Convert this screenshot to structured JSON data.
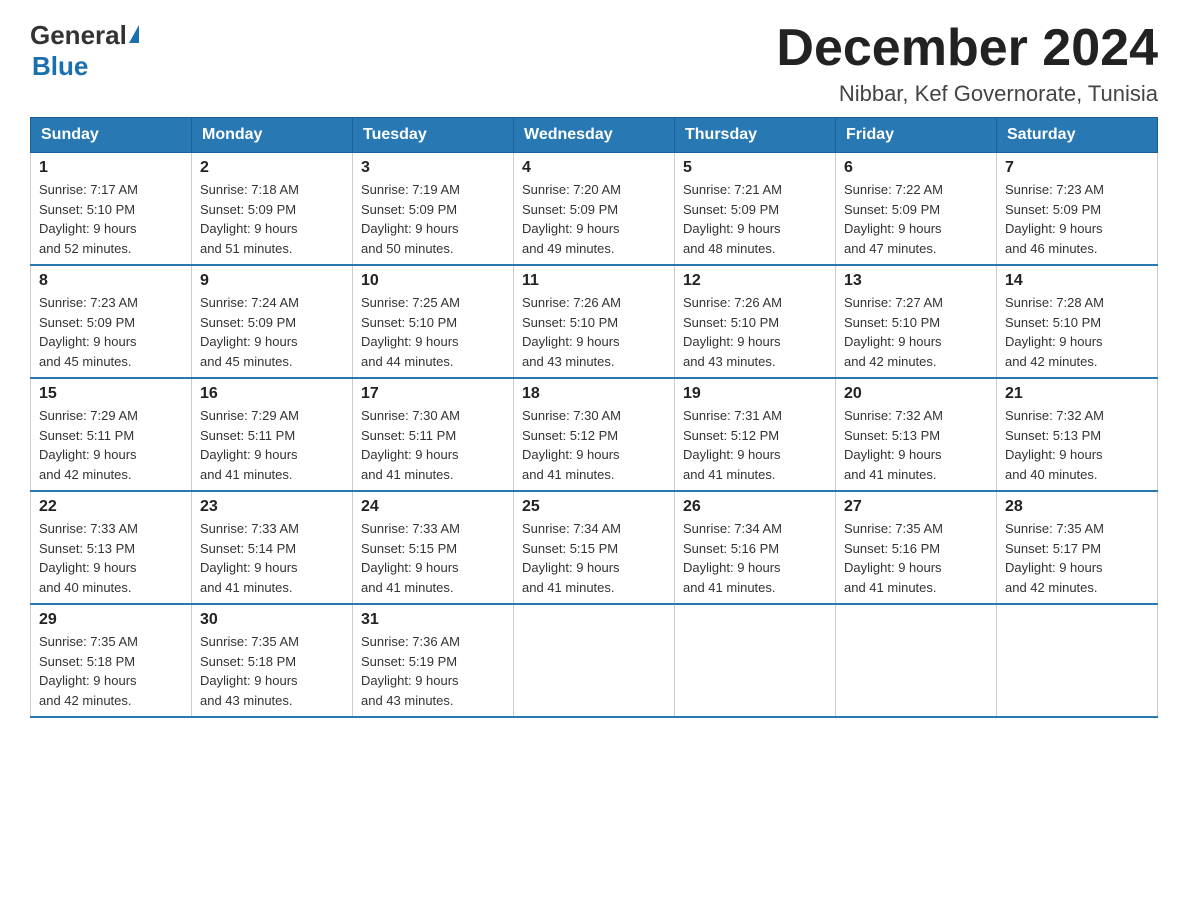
{
  "logo": {
    "general": "General",
    "blue": "Blue"
  },
  "header": {
    "month_year": "December 2024",
    "location": "Nibbar, Kef Governorate, Tunisia"
  },
  "days_of_week": [
    "Sunday",
    "Monday",
    "Tuesday",
    "Wednesday",
    "Thursday",
    "Friday",
    "Saturday"
  ],
  "weeks": [
    [
      {
        "day": "1",
        "sunrise": "7:17 AM",
        "sunset": "5:10 PM",
        "daylight": "9 hours and 52 minutes."
      },
      {
        "day": "2",
        "sunrise": "7:18 AM",
        "sunset": "5:09 PM",
        "daylight": "9 hours and 51 minutes."
      },
      {
        "day": "3",
        "sunrise": "7:19 AM",
        "sunset": "5:09 PM",
        "daylight": "9 hours and 50 minutes."
      },
      {
        "day": "4",
        "sunrise": "7:20 AM",
        "sunset": "5:09 PM",
        "daylight": "9 hours and 49 minutes."
      },
      {
        "day": "5",
        "sunrise": "7:21 AM",
        "sunset": "5:09 PM",
        "daylight": "9 hours and 48 minutes."
      },
      {
        "day": "6",
        "sunrise": "7:22 AM",
        "sunset": "5:09 PM",
        "daylight": "9 hours and 47 minutes."
      },
      {
        "day": "7",
        "sunrise": "7:23 AM",
        "sunset": "5:09 PM",
        "daylight": "9 hours and 46 minutes."
      }
    ],
    [
      {
        "day": "8",
        "sunrise": "7:23 AM",
        "sunset": "5:09 PM",
        "daylight": "9 hours and 45 minutes."
      },
      {
        "day": "9",
        "sunrise": "7:24 AM",
        "sunset": "5:09 PM",
        "daylight": "9 hours and 45 minutes."
      },
      {
        "day": "10",
        "sunrise": "7:25 AM",
        "sunset": "5:10 PM",
        "daylight": "9 hours and 44 minutes."
      },
      {
        "day": "11",
        "sunrise": "7:26 AM",
        "sunset": "5:10 PM",
        "daylight": "9 hours and 43 minutes."
      },
      {
        "day": "12",
        "sunrise": "7:26 AM",
        "sunset": "5:10 PM",
        "daylight": "9 hours and 43 minutes."
      },
      {
        "day": "13",
        "sunrise": "7:27 AM",
        "sunset": "5:10 PM",
        "daylight": "9 hours and 42 minutes."
      },
      {
        "day": "14",
        "sunrise": "7:28 AM",
        "sunset": "5:10 PM",
        "daylight": "9 hours and 42 minutes."
      }
    ],
    [
      {
        "day": "15",
        "sunrise": "7:29 AM",
        "sunset": "5:11 PM",
        "daylight": "9 hours and 42 minutes."
      },
      {
        "day": "16",
        "sunrise": "7:29 AM",
        "sunset": "5:11 PM",
        "daylight": "9 hours and 41 minutes."
      },
      {
        "day": "17",
        "sunrise": "7:30 AM",
        "sunset": "5:11 PM",
        "daylight": "9 hours and 41 minutes."
      },
      {
        "day": "18",
        "sunrise": "7:30 AM",
        "sunset": "5:12 PM",
        "daylight": "9 hours and 41 minutes."
      },
      {
        "day": "19",
        "sunrise": "7:31 AM",
        "sunset": "5:12 PM",
        "daylight": "9 hours and 41 minutes."
      },
      {
        "day": "20",
        "sunrise": "7:32 AM",
        "sunset": "5:13 PM",
        "daylight": "9 hours and 41 minutes."
      },
      {
        "day": "21",
        "sunrise": "7:32 AM",
        "sunset": "5:13 PM",
        "daylight": "9 hours and 40 minutes."
      }
    ],
    [
      {
        "day": "22",
        "sunrise": "7:33 AM",
        "sunset": "5:13 PM",
        "daylight": "9 hours and 40 minutes."
      },
      {
        "day": "23",
        "sunrise": "7:33 AM",
        "sunset": "5:14 PM",
        "daylight": "9 hours and 41 minutes."
      },
      {
        "day": "24",
        "sunrise": "7:33 AM",
        "sunset": "5:15 PM",
        "daylight": "9 hours and 41 minutes."
      },
      {
        "day": "25",
        "sunrise": "7:34 AM",
        "sunset": "5:15 PM",
        "daylight": "9 hours and 41 minutes."
      },
      {
        "day": "26",
        "sunrise": "7:34 AM",
        "sunset": "5:16 PM",
        "daylight": "9 hours and 41 minutes."
      },
      {
        "day": "27",
        "sunrise": "7:35 AM",
        "sunset": "5:16 PM",
        "daylight": "9 hours and 41 minutes."
      },
      {
        "day": "28",
        "sunrise": "7:35 AM",
        "sunset": "5:17 PM",
        "daylight": "9 hours and 42 minutes."
      }
    ],
    [
      {
        "day": "29",
        "sunrise": "7:35 AM",
        "sunset": "5:18 PM",
        "daylight": "9 hours and 42 minutes."
      },
      {
        "day": "30",
        "sunrise": "7:35 AM",
        "sunset": "5:18 PM",
        "daylight": "9 hours and 43 minutes."
      },
      {
        "day": "31",
        "sunrise": "7:36 AM",
        "sunset": "5:19 PM",
        "daylight": "9 hours and 43 minutes."
      },
      null,
      null,
      null,
      null
    ]
  ]
}
